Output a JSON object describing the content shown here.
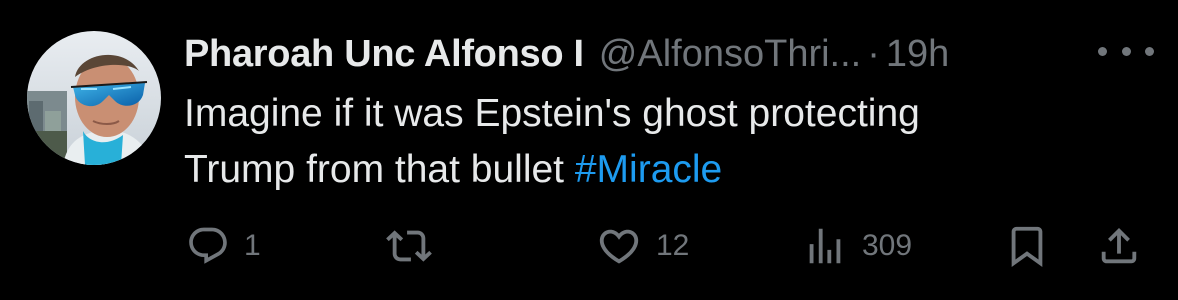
{
  "tweet": {
    "author": {
      "display_name": "Pharoah Unc Alfonso I",
      "handle": "@AlfonsoThri...",
      "separator": "·",
      "time": "19h"
    },
    "body": {
      "line1": "Imagine if it was Epstein's ghost protecting",
      "line2_text": "Trump from that bullet ",
      "hashtag": "#Miracle"
    },
    "actions": {
      "reply_count": "1",
      "retweet_count": "",
      "like_count": "12",
      "views_count": "309"
    },
    "icons": {
      "more": "more-dots-icon",
      "reply": "reply-icon",
      "retweet": "retweet-icon",
      "like": "heart-icon",
      "views": "views-icon",
      "bookmark": "bookmark-icon",
      "share": "share-icon"
    },
    "colors": {
      "background": "#000000",
      "text": "#e7e9ea",
      "muted": "#71767b",
      "link": "#1d9bf0"
    }
  }
}
